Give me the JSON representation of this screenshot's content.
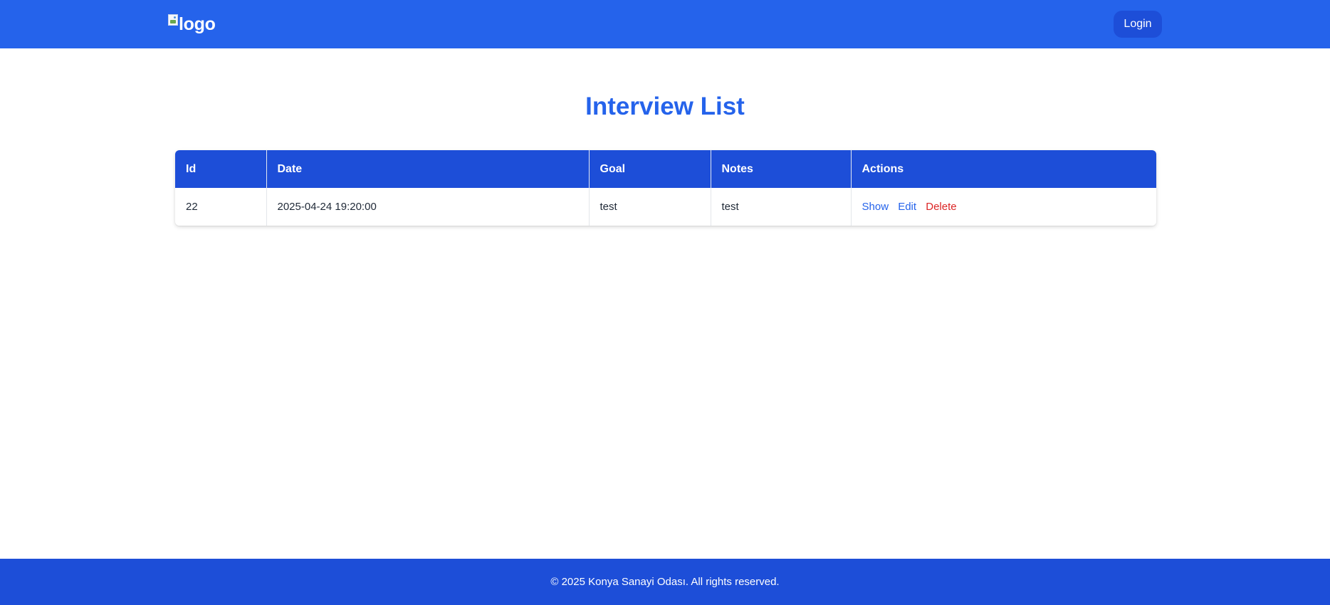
{
  "header": {
    "logo_alt": "logo",
    "login_label": "Login"
  },
  "main": {
    "title": "Interview List",
    "table": {
      "columns": [
        "Id",
        "Date",
        "Goal",
        "Notes",
        "Actions"
      ],
      "rows": [
        {
          "id": "22",
          "date": "2025-04-24 19:20:00",
          "goal": "test",
          "notes": "test",
          "actions": {
            "show": "Show",
            "edit": "Edit",
            "delete": "Delete"
          }
        }
      ]
    }
  },
  "footer": {
    "text": "© 2025 Konya Sanayi Odası. All rights reserved."
  },
  "colors": {
    "header_bg": "#2563eb",
    "footer_bg": "#1d4ed8",
    "table_header_bg": "#1d4ed8",
    "link": "#2563eb",
    "danger": "#dc2626"
  }
}
